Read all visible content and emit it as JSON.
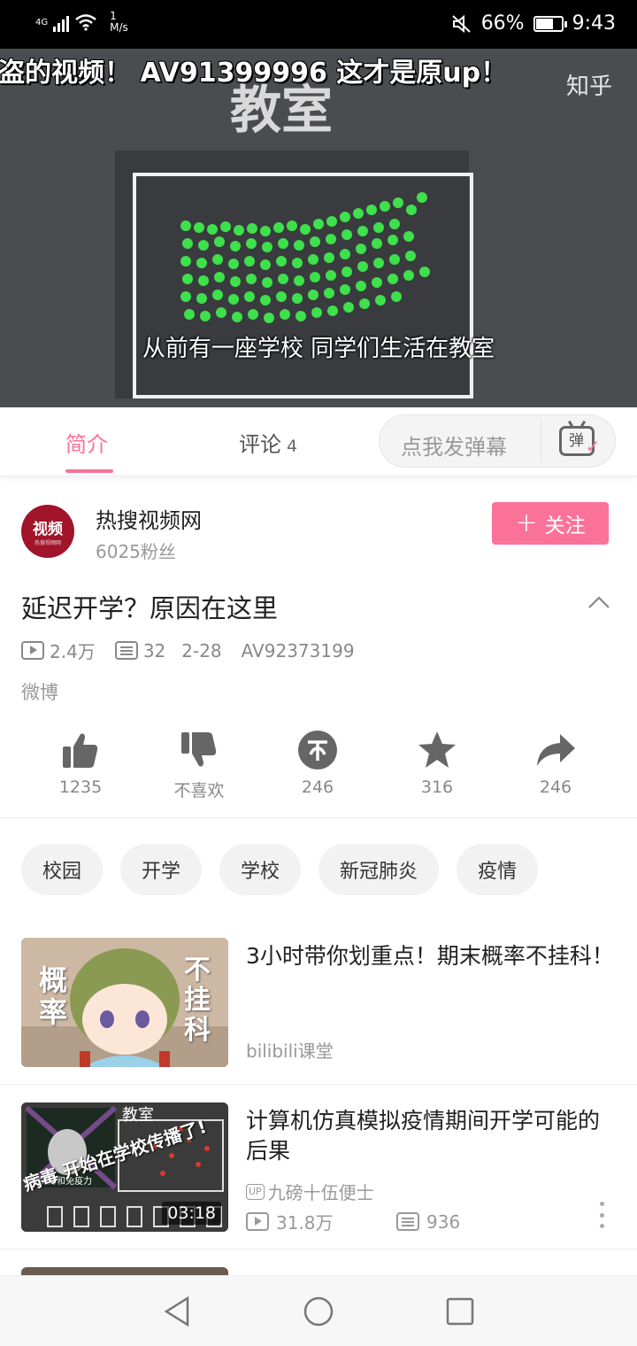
{
  "status_bar": {
    "network": "4G",
    "speed_value": "1",
    "speed_unit": "M/s",
    "battery": "66%",
    "time": "9:43"
  },
  "video": {
    "danmaku": "盗的视频！ AV91399996  这才是原up！",
    "watermark": "知乎",
    "scene_label": "教室",
    "subtitle": "从前有一座学校 同学们生活在教室"
  },
  "tabs": [
    {
      "label": "简介",
      "active": true
    },
    {
      "label": "评论",
      "count": "4",
      "active": false
    }
  ],
  "danmaku_input": {
    "placeholder": "点我发弹幕",
    "button_text": "弹"
  },
  "uploader": {
    "avatar_text": "视频",
    "avatar_subtext": "热搜视频网",
    "name": "热搜视频网",
    "fans": "6025粉丝",
    "follow_label": "关注"
  },
  "video_info": {
    "title": "延迟开学？原因在这里",
    "views": "2.4万",
    "danmaku_count": "32",
    "date": "2-28",
    "av_id": "AV92373199",
    "source": "微博"
  },
  "actions": [
    {
      "name": "like",
      "label": "1235"
    },
    {
      "name": "dislike",
      "label": "不喜欢"
    },
    {
      "name": "coin",
      "label": "246"
    },
    {
      "name": "favorite",
      "label": "316"
    },
    {
      "name": "share",
      "label": "246"
    }
  ],
  "tags": [
    "校园",
    "开学",
    "学校",
    "新冠肺炎",
    "疫情"
  ],
  "recommended": [
    {
      "title": "3小时带你划重点！期末概率不挂科！",
      "source": "bilibili课堂",
      "thumb_text_left": "概率",
      "thumb_text_right": "不挂科"
    },
    {
      "title": "计算机仿真模拟疫情期间开学可能的后果",
      "uploader": "九磅十伍便士",
      "up_badge": "UP",
      "views": "31.8万",
      "danmaku": "936",
      "duration": "03:18",
      "thumb_caption": "病毒 开始在学校传播了!",
      "thumb_label": "教室",
      "thumb_small": "抵抗力和免疫力"
    }
  ],
  "colors": {
    "accent": "#fb7299",
    "video_bg": "#4a4c50",
    "status_bar": "#000000"
  }
}
